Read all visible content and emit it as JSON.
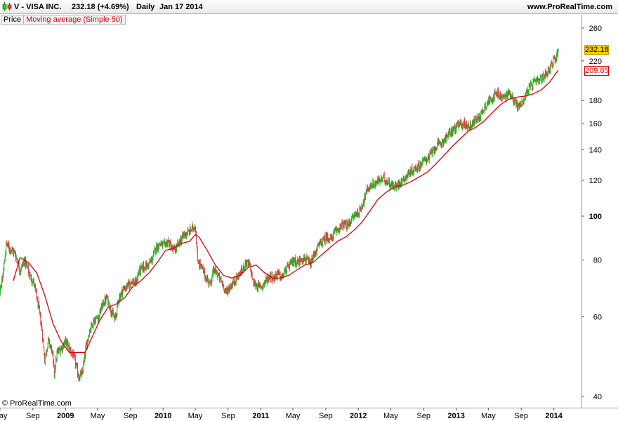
{
  "header": {
    "title": "V - VISA INC.",
    "price_change": "232.18 (+4.69%)",
    "period": "Daily",
    "date": "Jan 17 2014",
    "site": "www.ProRealTime.com"
  },
  "legend": {
    "price_label": "Price",
    "indicator_label": "Moving average (Simple 50)"
  },
  "copyright": "© ProRealTime.com",
  "badges": {
    "last_price": "232.18",
    "ma_value": "209.85"
  },
  "colors": {
    "up_bar": "#22b222",
    "down_bar": "#d94040",
    "moving_average": "#e00000",
    "last_price_badge": "#ffcc00"
  },
  "chart_data": {
    "type": "line",
    "title": "V - VISA INC.",
    "y_scale": "log",
    "ylim": [
      38,
      280
    ],
    "xlim": [
      "2008-05-01",
      "2014-02-05"
    ],
    "y_ticks": [
      40,
      60,
      80,
      100,
      120,
      140,
      160,
      180,
      220,
      260
    ],
    "x_ticks": [
      {
        "date": "2008-05-01",
        "label": "May",
        "major": false
      },
      {
        "date": "2008-09-01",
        "label": "Sep",
        "major": false
      },
      {
        "date": "2009-01-01",
        "label": "2009",
        "major": true
      },
      {
        "date": "2009-05-01",
        "label": "May",
        "major": false
      },
      {
        "date": "2009-09-01",
        "label": "Sep",
        "major": false
      },
      {
        "date": "2010-01-01",
        "label": "2010",
        "major": true
      },
      {
        "date": "2010-05-01",
        "label": "May",
        "major": false
      },
      {
        "date": "2010-09-01",
        "label": "Sep",
        "major": false
      },
      {
        "date": "2011-01-01",
        "label": "2011",
        "major": true
      },
      {
        "date": "2011-05-01",
        "label": "May",
        "major": false
      },
      {
        "date": "2011-09-01",
        "label": "Sep",
        "major": false
      },
      {
        "date": "2012-01-01",
        "label": "2012",
        "major": true
      },
      {
        "date": "2012-05-01",
        "label": "May",
        "major": false
      },
      {
        "date": "2012-09-01",
        "label": "Sep",
        "major": false
      },
      {
        "date": "2013-01-01",
        "label": "2013",
        "major": true
      },
      {
        "date": "2013-05-01",
        "label": "May",
        "major": false
      },
      {
        "date": "2013-09-01",
        "label": "Sep",
        "major": false
      },
      {
        "date": "2014-01-01",
        "label": "2014",
        "major": true
      }
    ],
    "series": [
      {
        "name": "Price",
        "style": "bars",
        "points": [
          [
            "2008-04-20",
            66
          ],
          [
            "2008-05-10",
            72
          ],
          [
            "2008-05-25",
            87
          ],
          [
            "2008-06-05",
            85
          ],
          [
            "2008-06-25",
            83
          ],
          [
            "2008-07-15",
            76
          ],
          [
            "2008-08-01",
            80
          ],
          [
            "2008-08-20",
            74
          ],
          [
            "2008-09-05",
            71
          ],
          [
            "2008-09-20",
            64
          ],
          [
            "2008-10-05",
            56
          ],
          [
            "2008-10-15",
            48
          ],
          [
            "2008-10-28",
            53
          ],
          [
            "2008-11-10",
            51
          ],
          [
            "2008-11-20",
            45
          ],
          [
            "2008-12-01",
            50
          ],
          [
            "2008-12-15",
            51
          ],
          [
            "2009-01-01",
            53
          ],
          [
            "2009-01-15",
            51
          ],
          [
            "2009-02-01",
            49
          ],
          [
            "2009-02-20",
            44
          ],
          [
            "2009-03-05",
            45
          ],
          [
            "2009-03-20",
            52
          ],
          [
            "2009-04-05",
            57
          ],
          [
            "2009-04-20",
            59
          ],
          [
            "2009-05-05",
            60
          ],
          [
            "2009-05-20",
            64
          ],
          [
            "2009-06-05",
            66
          ],
          [
            "2009-06-20",
            62
          ],
          [
            "2009-07-05",
            59
          ],
          [
            "2009-07-20",
            66
          ],
          [
            "2009-08-05",
            69
          ],
          [
            "2009-08-20",
            70
          ],
          [
            "2009-09-05",
            72
          ],
          [
            "2009-09-20",
            71
          ],
          [
            "2009-10-05",
            76
          ],
          [
            "2009-10-20",
            77
          ],
          [
            "2009-11-05",
            78
          ],
          [
            "2009-11-20",
            80
          ],
          [
            "2009-12-05",
            85
          ],
          [
            "2009-12-20",
            87
          ],
          [
            "2010-01-05",
            86
          ],
          [
            "2010-01-20",
            88
          ],
          [
            "2010-02-05",
            84
          ],
          [
            "2010-02-20",
            85
          ],
          [
            "2010-03-05",
            88
          ],
          [
            "2010-03-20",
            91
          ],
          [
            "2010-04-05",
            92
          ],
          [
            "2010-04-20",
            94
          ],
          [
            "2010-05-01",
            95
          ],
          [
            "2010-05-10",
            80
          ],
          [
            "2010-05-25",
            77
          ],
          [
            "2010-06-10",
            73
          ],
          [
            "2010-06-25",
            71
          ],
          [
            "2010-07-10",
            76
          ],
          [
            "2010-07-25",
            74
          ],
          [
            "2010-08-10",
            71
          ],
          [
            "2010-08-25",
            68
          ],
          [
            "2010-09-10",
            70
          ],
          [
            "2010-09-25",
            72
          ],
          [
            "2010-10-10",
            74
          ],
          [
            "2010-10-25",
            76
          ],
          [
            "2010-11-05",
            79
          ],
          [
            "2010-11-20",
            78
          ],
          [
            "2010-12-05",
            71
          ],
          [
            "2010-12-20",
            70
          ],
          [
            "2011-01-05",
            70
          ],
          [
            "2011-01-20",
            72
          ],
          [
            "2011-02-05",
            74
          ],
          [
            "2011-02-20",
            73
          ],
          [
            "2011-03-05",
            75
          ],
          [
            "2011-03-20",
            73
          ],
          [
            "2011-04-05",
            76
          ],
          [
            "2011-04-20",
            78
          ],
          [
            "2011-05-05",
            80
          ],
          [
            "2011-05-20",
            79
          ],
          [
            "2011-06-05",
            81
          ],
          [
            "2011-06-20",
            80
          ],
          [
            "2011-07-05",
            78
          ],
          [
            "2011-07-20",
            82
          ],
          [
            "2011-08-05",
            86
          ],
          [
            "2011-08-20",
            88
          ],
          [
            "2011-09-05",
            90
          ],
          [
            "2011-09-20",
            89
          ],
          [
            "2011-10-05",
            92
          ],
          [
            "2011-10-20",
            94
          ],
          [
            "2011-11-05",
            96
          ],
          [
            "2011-11-20",
            95
          ],
          [
            "2011-12-05",
            98
          ],
          [
            "2011-12-20",
            101
          ],
          [
            "2012-01-05",
            102
          ],
          [
            "2012-01-20",
            108
          ],
          [
            "2012-02-05",
            115
          ],
          [
            "2012-02-20",
            117
          ],
          [
            "2012-03-05",
            118
          ],
          [
            "2012-03-20",
            120
          ],
          [
            "2012-04-05",
            121
          ],
          [
            "2012-04-20",
            119
          ],
          [
            "2012-05-05",
            117
          ],
          [
            "2012-05-20",
            116
          ],
          [
            "2012-06-05",
            119
          ],
          [
            "2012-06-20",
            121
          ],
          [
            "2012-07-05",
            124
          ],
          [
            "2012-07-20",
            126
          ],
          [
            "2012-08-05",
            128
          ],
          [
            "2012-08-20",
            130
          ],
          [
            "2012-09-05",
            133
          ],
          [
            "2012-09-20",
            135
          ],
          [
            "2012-10-05",
            139
          ],
          [
            "2012-10-20",
            143
          ],
          [
            "2012-11-05",
            145
          ],
          [
            "2012-11-20",
            148
          ],
          [
            "2012-12-05",
            152
          ],
          [
            "2012-12-20",
            155
          ],
          [
            "2013-01-05",
            158
          ],
          [
            "2013-01-20",
            160
          ],
          [
            "2013-02-05",
            159
          ],
          [
            "2013-02-20",
            158
          ],
          [
            "2013-03-05",
            161
          ],
          [
            "2013-03-20",
            164
          ],
          [
            "2013-04-05",
            168
          ],
          [
            "2013-04-20",
            176
          ],
          [
            "2013-05-05",
            180
          ],
          [
            "2013-05-20",
            184
          ],
          [
            "2013-06-05",
            186
          ],
          [
            "2013-06-20",
            182
          ],
          [
            "2013-07-05",
            184
          ],
          [
            "2013-07-20",
            188
          ],
          [
            "2013-08-05",
            180
          ],
          [
            "2013-08-20",
            174
          ],
          [
            "2013-09-05",
            178
          ],
          [
            "2013-09-20",
            187
          ],
          [
            "2013-10-05",
            193
          ],
          [
            "2013-10-20",
            197
          ],
          [
            "2013-11-05",
            199
          ],
          [
            "2013-11-20",
            202
          ],
          [
            "2013-12-05",
            207
          ],
          [
            "2013-12-20",
            214
          ],
          [
            "2014-01-05",
            222
          ],
          [
            "2014-01-17",
            232.18
          ]
        ]
      },
      {
        "name": "Moving average (Simple 50)",
        "style": "line",
        "points": [
          [
            "2008-06-20",
            72
          ],
          [
            "2008-07-15",
            81
          ],
          [
            "2008-08-15",
            79
          ],
          [
            "2008-09-15",
            75
          ],
          [
            "2008-10-15",
            67
          ],
          [
            "2008-11-15",
            58
          ],
          [
            "2008-12-15",
            53
          ],
          [
            "2009-01-15",
            50
          ],
          [
            "2009-02-15",
            50
          ],
          [
            "2009-03-15",
            50
          ],
          [
            "2009-04-10",
            54
          ],
          [
            "2009-05-10",
            59
          ],
          [
            "2009-06-10",
            63
          ],
          [
            "2009-07-10",
            64
          ],
          [
            "2009-08-10",
            66
          ],
          [
            "2009-09-10",
            70
          ],
          [
            "2009-10-10",
            72
          ],
          [
            "2009-11-10",
            75
          ],
          [
            "2009-12-10",
            79
          ],
          [
            "2010-01-10",
            84
          ],
          [
            "2010-02-10",
            85
          ],
          [
            "2010-03-10",
            87
          ],
          [
            "2010-04-10",
            88
          ],
          [
            "2010-05-01",
            91
          ],
          [
            "2010-05-15",
            90
          ],
          [
            "2010-06-15",
            84
          ],
          [
            "2010-07-15",
            78
          ],
          [
            "2010-08-15",
            74
          ],
          [
            "2010-09-15",
            73
          ],
          [
            "2010-10-15",
            74
          ],
          [
            "2010-11-15",
            77
          ],
          [
            "2010-12-15",
            78
          ],
          [
            "2011-01-15",
            75
          ],
          [
            "2011-02-15",
            73
          ],
          [
            "2011-03-15",
            73
          ],
          [
            "2011-04-15",
            74
          ],
          [
            "2011-05-15",
            76
          ],
          [
            "2011-06-15",
            78
          ],
          [
            "2011-07-15",
            79
          ],
          [
            "2011-08-15",
            82
          ],
          [
            "2011-09-15",
            85
          ],
          [
            "2011-10-15",
            88
          ],
          [
            "2011-11-15",
            90
          ],
          [
            "2011-12-15",
            93
          ],
          [
            "2012-01-15",
            97
          ],
          [
            "2012-02-15",
            103
          ],
          [
            "2012-03-15",
            109
          ],
          [
            "2012-04-15",
            113
          ],
          [
            "2012-05-15",
            116
          ],
          [
            "2012-06-15",
            117
          ],
          [
            "2012-07-15",
            119
          ],
          [
            "2012-08-15",
            122
          ],
          [
            "2012-09-15",
            125
          ],
          [
            "2012-10-15",
            130
          ],
          [
            "2012-11-15",
            136
          ],
          [
            "2012-12-15",
            142
          ],
          [
            "2013-01-15",
            148
          ],
          [
            "2013-02-15",
            154
          ],
          [
            "2013-03-15",
            157
          ],
          [
            "2013-04-15",
            162
          ],
          [
            "2013-05-15",
            169
          ],
          [
            "2013-06-15",
            176
          ],
          [
            "2013-07-15",
            181
          ],
          [
            "2013-08-15",
            183
          ],
          [
            "2013-09-15",
            184
          ],
          [
            "2013-10-15",
            186
          ],
          [
            "2013-11-15",
            190
          ],
          [
            "2013-12-15",
            197
          ],
          [
            "2014-01-17",
            209.85
          ]
        ]
      }
    ]
  }
}
